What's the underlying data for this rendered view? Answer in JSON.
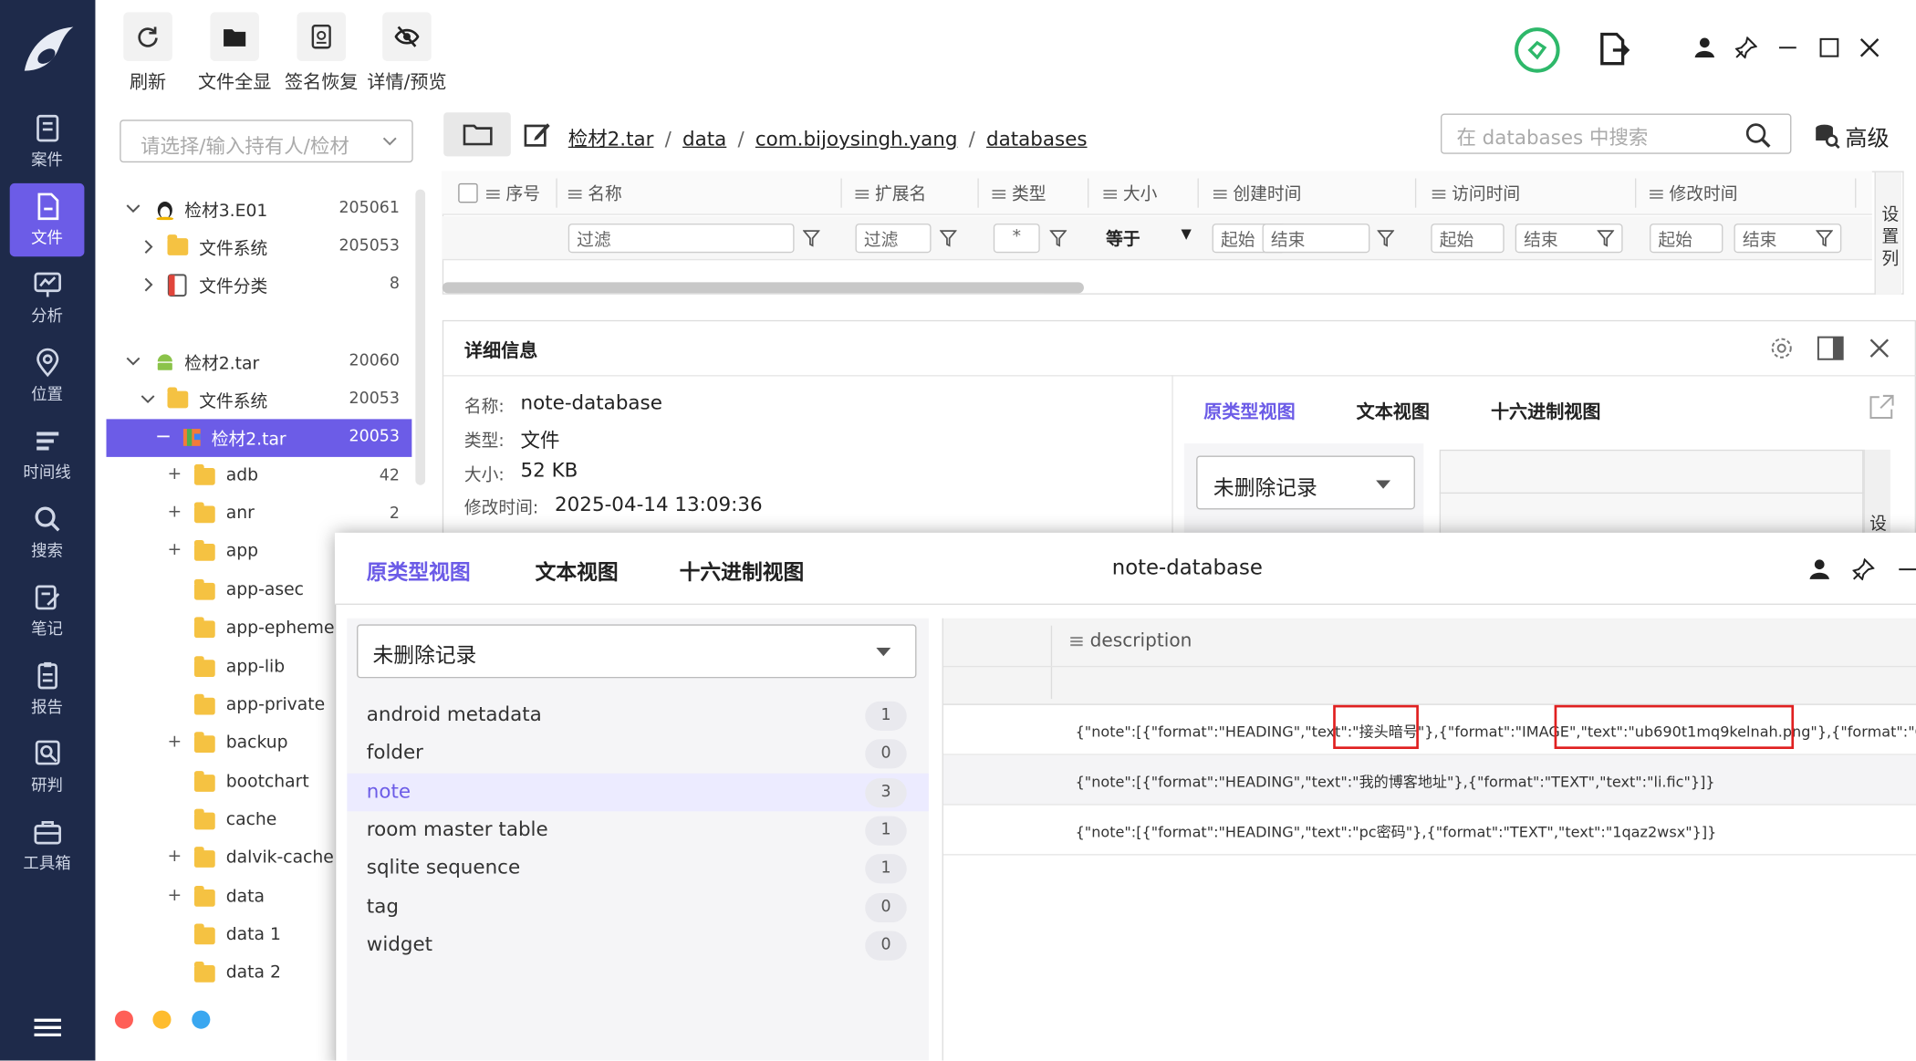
{
  "nav": {
    "items": [
      {
        "label": "案件",
        "icon": "case-icon"
      },
      {
        "label": "文件",
        "icon": "file-icon",
        "active": true
      },
      {
        "label": "分析",
        "icon": "analysis-icon"
      },
      {
        "label": "位置",
        "icon": "location-icon"
      },
      {
        "label": "时间线",
        "icon": "timeline-icon"
      },
      {
        "label": "搜索",
        "icon": "search-icon"
      },
      {
        "label": "笔记",
        "icon": "notes-icon"
      },
      {
        "label": "报告",
        "icon": "report-icon"
      },
      {
        "label": "研判",
        "icon": "judge-icon"
      },
      {
        "label": "工具箱",
        "icon": "toolbox-icon"
      }
    ]
  },
  "toolbar": {
    "refresh": "刷新",
    "show_all": "文件全显",
    "sig_recover": "签名恢复",
    "detail_preview": "详情/预览"
  },
  "owner_select": {
    "placeholder": "请选择/输入持有人/检材"
  },
  "tree": [
    {
      "label": "检材3.E01",
      "count": "205061"
    },
    {
      "label": "文件系统",
      "count": "205053"
    },
    {
      "label": "文件分类",
      "count": "8"
    },
    {
      "label": "检材2.tar",
      "count": "20060"
    },
    {
      "label": "文件系统",
      "count": "20053"
    },
    {
      "label": "检材2.tar",
      "count": "20053"
    },
    {
      "label": "adb",
      "count": "42"
    },
    {
      "label": "anr",
      "count": "2"
    },
    {
      "label": "app",
      "count": ""
    },
    {
      "label": "app-asec",
      "count": ""
    },
    {
      "label": "app-ephemeral",
      "count": ""
    },
    {
      "label": "app-lib",
      "count": ""
    },
    {
      "label": "app-private",
      "count": ""
    },
    {
      "label": "backup",
      "count": ""
    },
    {
      "label": "bootchart",
      "count": ""
    },
    {
      "label": "cache",
      "count": ""
    },
    {
      "label": "dalvik-cache",
      "count": ""
    },
    {
      "label": "data",
      "count": ""
    },
    {
      "label": "data 1",
      "count": ""
    },
    {
      "label": "data 2",
      "count": ""
    }
  ],
  "breadcrumb": {
    "p1": "检材2.tar",
    "p2": "data",
    "p3": "com.bijoysingh.yang",
    "p4": "databases",
    "sep": "/"
  },
  "search": {
    "placeholder": "在 databases 中搜索",
    "advanced": "高级"
  },
  "file_table": {
    "headers": [
      "序号",
      "名称",
      "扩展名",
      "类型",
      "大小",
      "创建时间",
      "访问时间",
      "修改时间"
    ],
    "filter": "过滤",
    "star": "*",
    "equals": "等于",
    "start": "起始",
    "end": "结束",
    "settings": "设置列"
  },
  "details": {
    "title": "详细信息",
    "name_label": "名称:",
    "name": "note-database",
    "type_label": "类型:",
    "type": "文件",
    "size_label": "大小:",
    "size": "52 KB",
    "mtime_label": "修改时间:",
    "mtime": "2025-04-14 13:09:36",
    "tabs": [
      "原类型视图",
      "文本视图",
      "十六进制视图"
    ],
    "select": "未删除记录",
    "settings_short": "设"
  },
  "viewer": {
    "tabs": [
      "原类型视图",
      "文本视图",
      "十六进制视图"
    ],
    "title": "note-database",
    "select": "未删除记录",
    "tables": [
      {
        "name": "android metadata",
        "count": "1"
      },
      {
        "name": "folder",
        "count": "0"
      },
      {
        "name": "note",
        "count": "3"
      },
      {
        "name": "room master table",
        "count": "1"
      },
      {
        "name": "sqlite sequence",
        "count": "1"
      },
      {
        "name": "tag",
        "count": "0"
      },
      {
        "name": "widget",
        "count": "0"
      }
    ],
    "column": "description",
    "rows": [
      "{\"note\":[{\"format\":\"HEADING\",\"text\":\"接头暗号\"},{\"format\":\"IMAGE\",\"text\":\"ub690t1mq9kelnah.png\"},{\"format\":\"CHECKLIST\"",
      "{\"note\":[{\"format\":\"HEADING\",\"text\":\"我的博客地址\"},{\"format\":\"TEXT\",\"text\":\"li.fic\"}]}",
      "{\"note\":[{\"format\":\"HEADING\",\"text\":\"pc密码\"},{\"format\":\"TEXT\",\"text\":\"1qaz2wsx\"}]}"
    ]
  },
  "colors": {
    "nav_bg": "#1e2a4a",
    "accent": "#6c5ce7",
    "highlight": "#e02020",
    "status_green": "#2eb86a"
  }
}
